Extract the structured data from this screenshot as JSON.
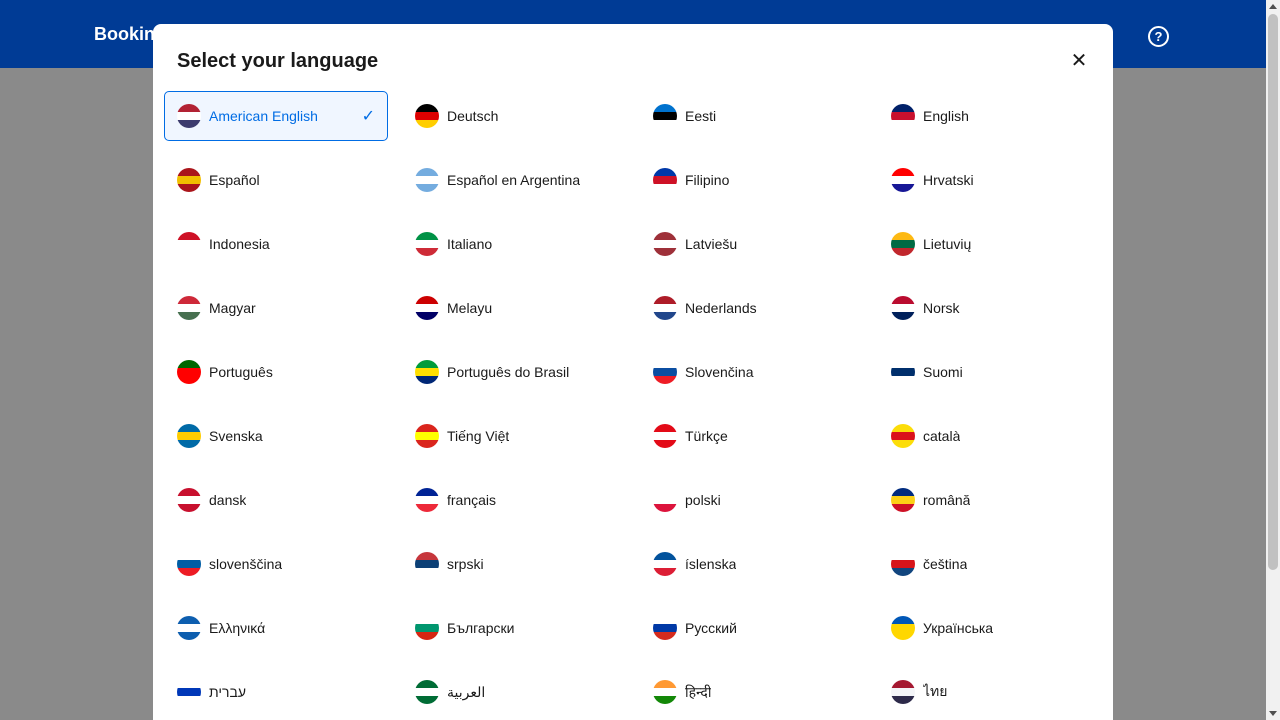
{
  "header": {
    "brand": "Booking.com",
    "help_icon": "question-circle-icon"
  },
  "modal": {
    "title": "Select your language",
    "close_icon": "close-icon",
    "languages": [
      {
        "label": "American English",
        "flag": [
          "#b22234",
          "#ffffff",
          "#3c3b6e"
        ],
        "selected": true
      },
      {
        "label": "Deutsch",
        "flag": [
          "#000000",
          "#dd0000",
          "#ffce00"
        ],
        "selected": false
      },
      {
        "label": "Eesti",
        "flag": [
          "#0072ce",
          "#000000",
          "#ffffff"
        ],
        "selected": false
      },
      {
        "label": "English",
        "flag": [
          "#012169",
          "#c8102e",
          "#ffffff"
        ],
        "selected": false
      },
      {
        "label": "Español",
        "flag": [
          "#aa151b",
          "#f1bf00",
          "#aa151b"
        ],
        "selected": false
      },
      {
        "label": "Español en Argentina",
        "flag": [
          "#74acdf",
          "#ffffff",
          "#74acdf"
        ],
        "selected": false
      },
      {
        "label": "Filipino",
        "flag": [
          "#0038a8",
          "#ce1126",
          "#ffffff"
        ],
        "selected": false
      },
      {
        "label": "Hrvatski",
        "flag": [
          "#ff0000",
          "#ffffff",
          "#171796"
        ],
        "selected": false
      },
      {
        "label": "Indonesia",
        "flag": [
          "#ce1126",
          "#ffffff",
          "#ffffff"
        ],
        "selected": false
      },
      {
        "label": "Italiano",
        "flag": [
          "#009246",
          "#ffffff",
          "#ce2b37"
        ],
        "selected": false
      },
      {
        "label": "Latviešu",
        "flag": [
          "#9e3039",
          "#ffffff",
          "#9e3039"
        ],
        "selected": false
      },
      {
        "label": "Lietuvių",
        "flag": [
          "#fdb913",
          "#006a44",
          "#c1272d"
        ],
        "selected": false
      },
      {
        "label": "Magyar",
        "flag": [
          "#ce2939",
          "#ffffff",
          "#477050"
        ],
        "selected": false
      },
      {
        "label": "Melayu",
        "flag": [
          "#cc0001",
          "#ffffff",
          "#010066"
        ],
        "selected": false
      },
      {
        "label": "Nederlands",
        "flag": [
          "#ae1c28",
          "#ffffff",
          "#21468b"
        ],
        "selected": false
      },
      {
        "label": "Norsk",
        "flag": [
          "#ba0c2f",
          "#ffffff",
          "#00205b"
        ],
        "selected": false
      },
      {
        "label": "Português",
        "flag": [
          "#006600",
          "#ff0000",
          "#ff0000"
        ],
        "selected": false
      },
      {
        "label": "Português do Brasil",
        "flag": [
          "#009c3b",
          "#ffdf00",
          "#002776"
        ],
        "selected": false
      },
      {
        "label": "Slovenčina",
        "flag": [
          "#ffffff",
          "#0b4ea2",
          "#ee1c25"
        ],
        "selected": false
      },
      {
        "label": "Suomi",
        "flag": [
          "#ffffff",
          "#002f6c",
          "#ffffff"
        ],
        "selected": false
      },
      {
        "label": "Svenska",
        "flag": [
          "#006aa7",
          "#fecc00",
          "#006aa7"
        ],
        "selected": false
      },
      {
        "label": "Tiếng Việt",
        "flag": [
          "#da251d",
          "#ffff00",
          "#da251d"
        ],
        "selected": false
      },
      {
        "label": "Türkçe",
        "flag": [
          "#e30a17",
          "#ffffff",
          "#e30a17"
        ],
        "selected": false
      },
      {
        "label": "català",
        "flag": [
          "#fcdd09",
          "#da121a",
          "#fcdd09"
        ],
        "selected": false
      },
      {
        "label": "dansk",
        "flag": [
          "#c8102e",
          "#ffffff",
          "#c8102e"
        ],
        "selected": false
      },
      {
        "label": "français",
        "flag": [
          "#002395",
          "#ffffff",
          "#ed2939"
        ],
        "selected": false
      },
      {
        "label": "polski",
        "flag": [
          "#ffffff",
          "#ffffff",
          "#dc143c"
        ],
        "selected": false
      },
      {
        "label": "română",
        "flag": [
          "#002b7f",
          "#fcd116",
          "#ce1126"
        ],
        "selected": false
      },
      {
        "label": "slovenščina",
        "flag": [
          "#ffffff",
          "#005da4",
          "#ed1c24"
        ],
        "selected": false
      },
      {
        "label": "srpski",
        "flag": [
          "#c6363c",
          "#0c4076",
          "#ffffff"
        ],
        "selected": false
      },
      {
        "label": "íslenska",
        "flag": [
          "#02529c",
          "#ffffff",
          "#dc1e35"
        ],
        "selected": false
      },
      {
        "label": "čeština",
        "flag": [
          "#ffffff",
          "#d7141a",
          "#11457e"
        ],
        "selected": false
      },
      {
        "label": "Ελληνικά",
        "flag": [
          "#0d5eaf",
          "#ffffff",
          "#0d5eaf"
        ],
        "selected": false
      },
      {
        "label": "Български",
        "flag": [
          "#ffffff",
          "#00966e",
          "#d62612"
        ],
        "selected": false
      },
      {
        "label": "Русский",
        "flag": [
          "#ffffff",
          "#0039a6",
          "#d52b1e"
        ],
        "selected": false
      },
      {
        "label": "Українська",
        "flag": [
          "#0057b7",
          "#ffd700",
          "#ffd700"
        ],
        "selected": false
      },
      {
        "label": "עברית",
        "flag": [
          "#ffffff",
          "#0038b8",
          "#ffffff"
        ],
        "selected": false
      },
      {
        "label": "العربية",
        "flag": [
          "#006c35",
          "#ffffff",
          "#006c35"
        ],
        "selected": false
      },
      {
        "label": "हिन्दी",
        "flag": [
          "#ff9933",
          "#ffffff",
          "#138808"
        ],
        "selected": false
      },
      {
        "label": "ไทย",
        "flag": [
          "#a51931",
          "#f4f5f8",
          "#2d2a4a"
        ],
        "selected": false
      }
    ]
  }
}
